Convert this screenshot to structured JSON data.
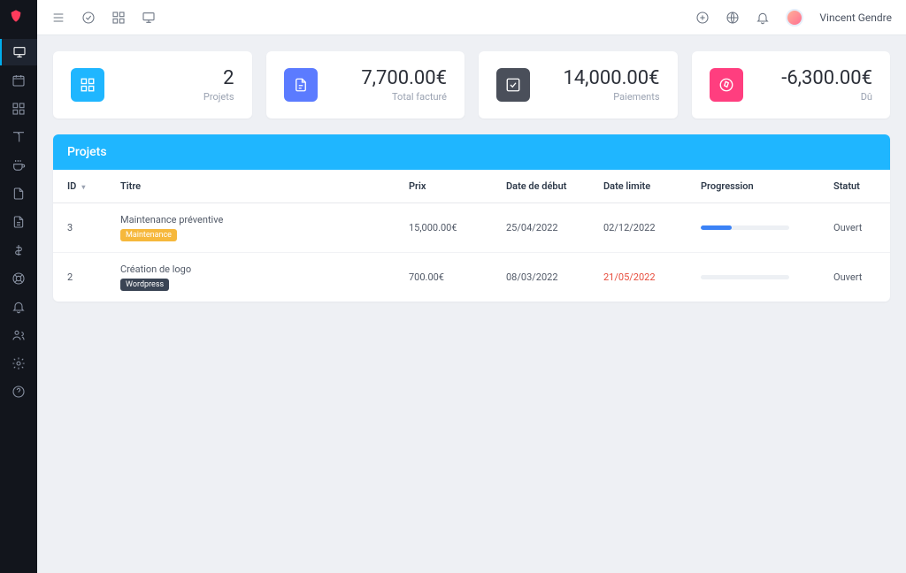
{
  "user": {
    "name": "Vincent Gendre"
  },
  "stats": [
    {
      "value": "2",
      "label": "Projets",
      "color": "#1fb6ff",
      "icon": "grid"
    },
    {
      "value": "7,700.00€",
      "label": "Total facturé",
      "color": "#5b7bff",
      "icon": "file"
    },
    {
      "value": "14,000.00€",
      "label": "Paiements",
      "color": "#4a4f5a",
      "icon": "check-square"
    },
    {
      "value": "-6,300.00€",
      "label": "Dû",
      "color": "#ff3e7f",
      "icon": "compass"
    }
  ],
  "panel": {
    "title": "Projets"
  },
  "columns": {
    "id": "ID",
    "title": "Titre",
    "price": "Prix",
    "start": "Date de début",
    "deadline": "Date limite",
    "progress": "Progression",
    "status": "Statut"
  },
  "rows": [
    {
      "id": "3",
      "title": "Maintenance préventive",
      "tag": {
        "label": "Maintenance",
        "color": "#f6b83c"
      },
      "price": "15,000.00€",
      "start": "25/04/2022",
      "deadline": "02/12/2022",
      "deadline_overdue": false,
      "progress_pct": 35,
      "progress_color": "#3b82f6",
      "status": "Ouvert"
    },
    {
      "id": "2",
      "title": "Création de logo",
      "tag": {
        "label": "Wordpress",
        "color": "#3a4454"
      },
      "price": "700.00€",
      "start": "08/03/2022",
      "deadline": "21/05/2022",
      "deadline_overdue": true,
      "progress_pct": 0,
      "progress_color": "#3b82f6",
      "status": "Ouvert"
    }
  ]
}
